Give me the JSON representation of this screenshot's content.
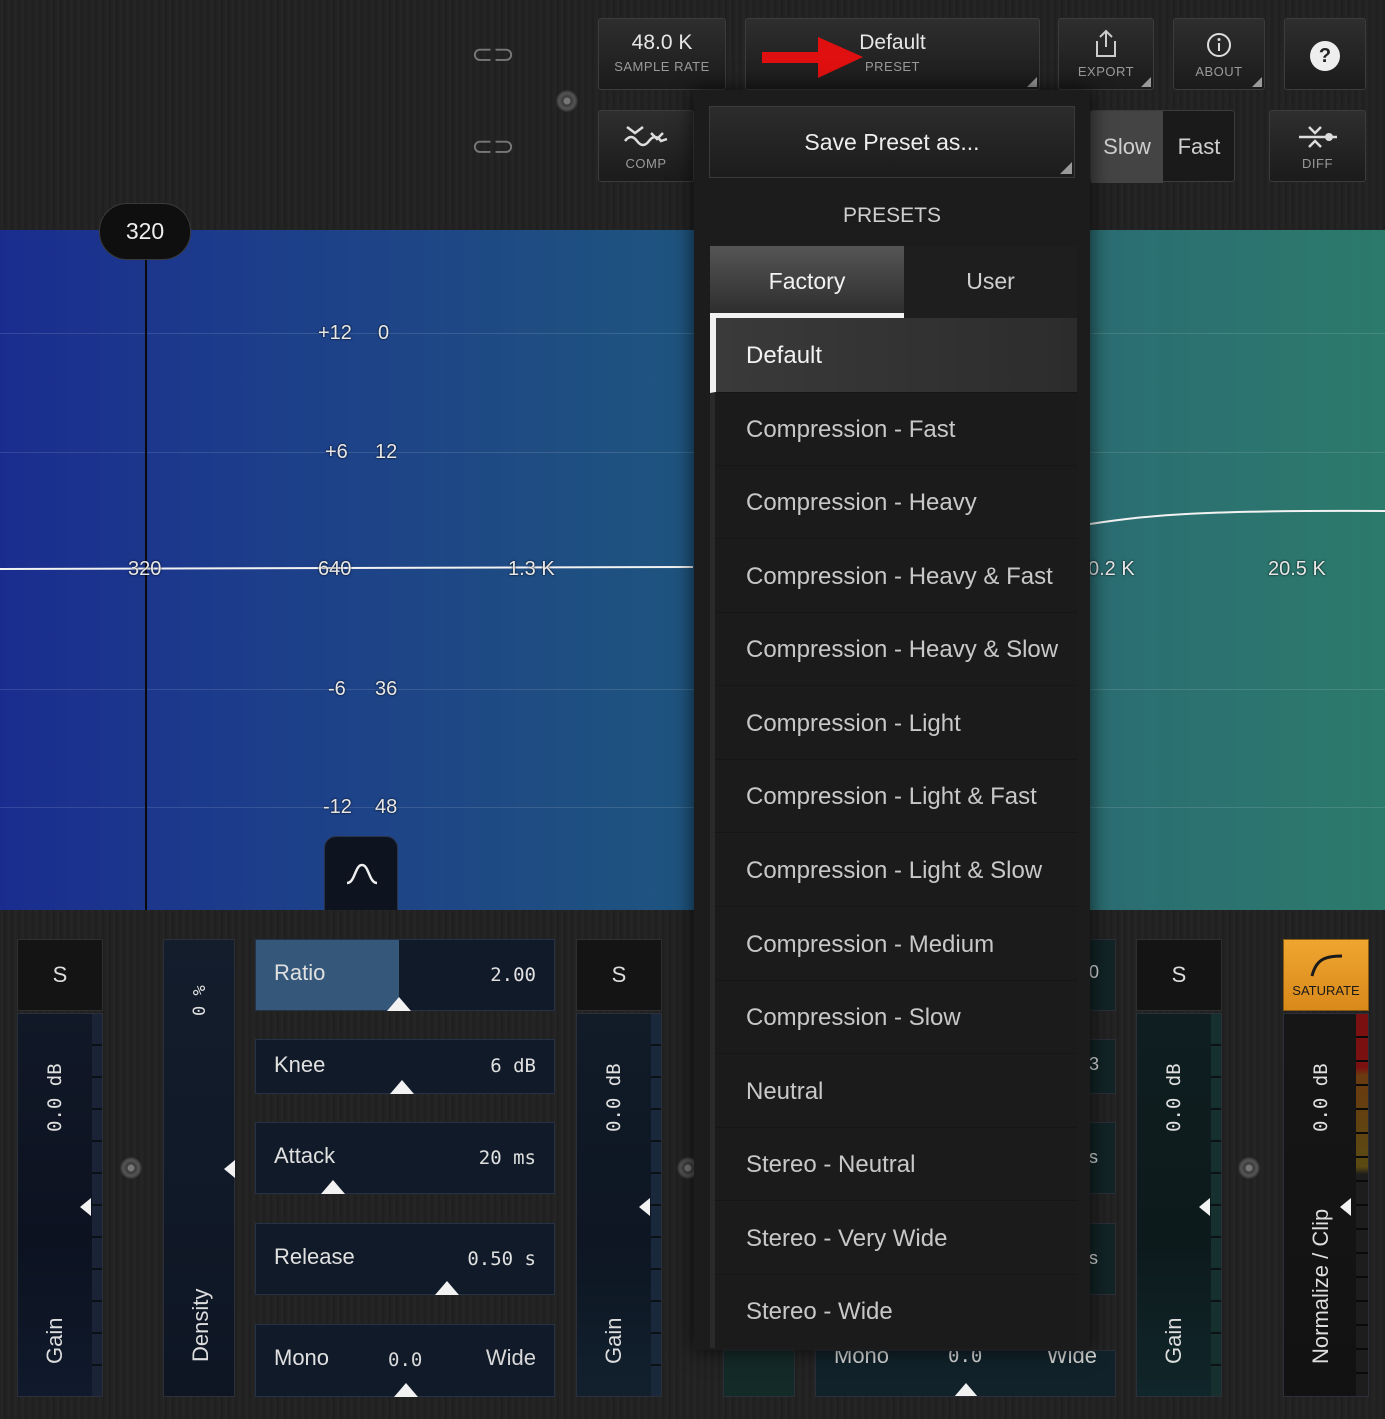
{
  "toolbar": {
    "sample_rate_value": "48.0 K",
    "sample_rate_label": "SAMPLE RATE",
    "preset_value": "Default",
    "preset_label": "PRESET",
    "export_label": "EXPORT",
    "about_label": "ABOUT",
    "help_glyph": "?",
    "comp_label": "COMP",
    "diff_label": "DIFF",
    "slow_label": "Slow",
    "fast_label": "Fast"
  },
  "graph": {
    "freq_marker": "320",
    "gain_labels": [
      "+12",
      "+6",
      "-6",
      "-12"
    ],
    "comp_labels": [
      "0",
      "12",
      "36",
      "48"
    ],
    "freq_labels": [
      "320",
      "640",
      "1.3 K",
      "0.2 K",
      "20.5 K"
    ]
  },
  "presets_menu": {
    "save_as": "Save Preset as...",
    "header": "PRESETS",
    "tabs": [
      "Factory",
      "User"
    ],
    "items": [
      "Default",
      "Compression - Fast",
      "Compression - Heavy",
      "Compression - Heavy & Fast",
      "Compression - Heavy & Slow",
      "Compression - Light",
      "Compression - Light & Fast",
      "Compression - Light & Slow",
      "Compression - Medium",
      "Compression - Slow",
      "Neutral",
      "Stereo - Neutral",
      "Stereo - Very Wide",
      "Stereo - Wide"
    ]
  },
  "bottom": {
    "solo": "S",
    "gain_value": "0.0 dB",
    "gain_label": "Gain",
    "density_value": "0 %",
    "density_label": "Density",
    "params": [
      {
        "label": "Ratio",
        "value": "2.00",
        "level": 0.48
      },
      {
        "label": "Knee",
        "value": "6 dB",
        "level": 0.49
      },
      {
        "label": "Attack",
        "value": "20 ms",
        "level": 0.26
      },
      {
        "label": "Release",
        "value": "0.50 s",
        "level": 0.64
      }
    ],
    "width": {
      "left": "Mono",
      "value": "0.0",
      "right": "Wide"
    },
    "saturate_label": "SATURATE",
    "normalize_label": "Normalize / Clip",
    "partial_values": [
      "0",
      "3",
      "s",
      "s"
    ],
    "partial_width_left": "Mono",
    "partial_width_value": "0.0",
    "partial_width_right": "Wide"
  },
  "colors": {
    "band_low": "#1a2d8f",
    "band_high": "#2c7a6c",
    "saturate": "#e49a2a",
    "arrow": "#e01010"
  }
}
